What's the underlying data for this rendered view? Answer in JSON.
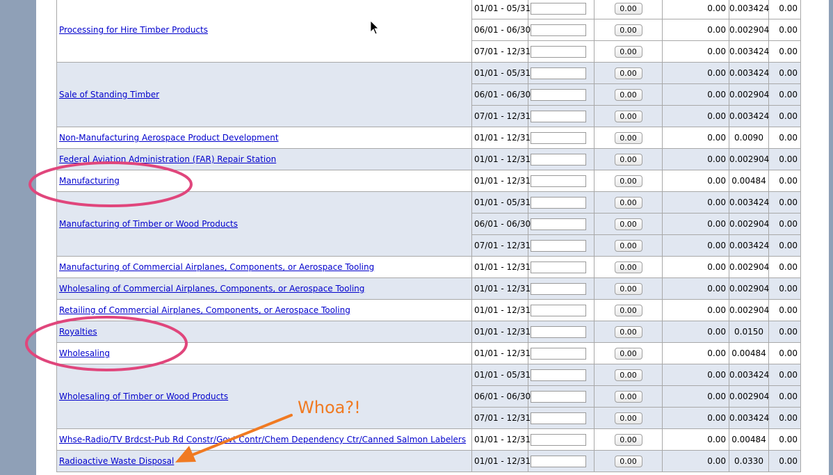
{
  "rows": [
    {
      "name": "Processing for Hire Timber Products",
      "alt": false,
      "periods": [
        {
          "dates": "01/01 - 05/31",
          "button": "0.00",
          "amount": "0.00",
          "rate": "0.003424",
          "tax": "0.00"
        },
        {
          "dates": "06/01 - 06/30",
          "button": "0.00",
          "amount": "0.00",
          "rate": "0.002904",
          "tax": "0.00"
        },
        {
          "dates": "07/01 - 12/31",
          "button": "0.00",
          "amount": "0.00",
          "rate": "0.003424",
          "tax": "0.00"
        }
      ]
    },
    {
      "name": "Sale of Standing Timber",
      "alt": true,
      "periods": [
        {
          "dates": "01/01 - 05/31",
          "button": "0.00",
          "amount": "0.00",
          "rate": "0.003424",
          "tax": "0.00"
        },
        {
          "dates": "06/01 - 06/30",
          "button": "0.00",
          "amount": "0.00",
          "rate": "0.002904",
          "tax": "0.00"
        },
        {
          "dates": "07/01 - 12/31",
          "button": "0.00",
          "amount": "0.00",
          "rate": "0.003424",
          "tax": "0.00"
        }
      ]
    },
    {
      "name": "Non-Manufacturing Aerospace Product Development",
      "alt": false,
      "periods": [
        {
          "dates": "01/01 - 12/31",
          "button": "0.00",
          "amount": "0.00",
          "rate": "0.0090",
          "tax": "0.00"
        }
      ]
    },
    {
      "name": "Federal Aviation Administration (FAR) Repair Station",
      "alt": true,
      "periods": [
        {
          "dates": "01/01 - 12/31",
          "button": "0.00",
          "amount": "0.00",
          "rate": "0.002904",
          "tax": "0.00"
        }
      ]
    },
    {
      "name": "Manufacturing",
      "alt": false,
      "periods": [
        {
          "dates": "01/01 - 12/31",
          "button": "0.00",
          "amount": "0.00",
          "rate": "0.00484",
          "tax": "0.00"
        }
      ]
    },
    {
      "name": "Manufacturing of Timber or Wood Products",
      "alt": true,
      "periods": [
        {
          "dates": "01/01 - 05/31",
          "button": "0.00",
          "amount": "0.00",
          "rate": "0.003424",
          "tax": "0.00"
        },
        {
          "dates": "06/01 - 06/30",
          "button": "0.00",
          "amount": "0.00",
          "rate": "0.002904",
          "tax": "0.00"
        },
        {
          "dates": "07/01 - 12/31",
          "button": "0.00",
          "amount": "0.00",
          "rate": "0.003424",
          "tax": "0.00"
        }
      ]
    },
    {
      "name": "Manufacturing of Commercial Airplanes, Components, or Aerospace Tooling",
      "alt": false,
      "periods": [
        {
          "dates": "01/01 - 12/31",
          "button": "0.00",
          "amount": "0.00",
          "rate": "0.002904",
          "tax": "0.00"
        }
      ]
    },
    {
      "name": "Wholesaling of Commercial Airplanes, Components, or Aerospace Tooling",
      "alt": true,
      "periods": [
        {
          "dates": "01/01 - 12/31",
          "button": "0.00",
          "amount": "0.00",
          "rate": "0.002904",
          "tax": "0.00"
        }
      ]
    },
    {
      "name": "Retailing of Commercial Airplanes, Components, or Aerospace Tooling",
      "alt": false,
      "periods": [
        {
          "dates": "01/01 - 12/31",
          "button": "0.00",
          "amount": "0.00",
          "rate": "0.002904",
          "tax": "0.00"
        }
      ]
    },
    {
      "name": "Royalties",
      "alt": true,
      "periods": [
        {
          "dates": "01/01 - 12/31",
          "button": "0.00",
          "amount": "0.00",
          "rate": "0.0150",
          "tax": "0.00"
        }
      ]
    },
    {
      "name": "Wholesaling",
      "alt": false,
      "periods": [
        {
          "dates": "01/01 - 12/31",
          "button": "0.00",
          "amount": "0.00",
          "rate": "0.00484",
          "tax": "0.00"
        }
      ]
    },
    {
      "name": "Wholesaling of Timber or Wood Products",
      "alt": true,
      "periods": [
        {
          "dates": "01/01 - 05/31",
          "button": "0.00",
          "amount": "0.00",
          "rate": "0.003424",
          "tax": "0.00"
        },
        {
          "dates": "06/01 - 06/30",
          "button": "0.00",
          "amount": "0.00",
          "rate": "0.002904",
          "tax": "0.00"
        },
        {
          "dates": "07/01 - 12/31",
          "button": "0.00",
          "amount": "0.00",
          "rate": "0.003424",
          "tax": "0.00"
        }
      ]
    },
    {
      "name": "Whse-Radio/TV Brdcst-Pub Rd Constr/Govt Contr/Chem Dependency Ctr/Canned Salmon Labelers",
      "alt": false,
      "periods": [
        {
          "dates": "01/01 - 12/31",
          "button": "0.00",
          "amount": "0.00",
          "rate": "0.00484",
          "tax": "0.00"
        }
      ]
    },
    {
      "name": "Radioactive Waste Disposal",
      "alt": true,
      "periods": [
        {
          "dates": "01/01 - 12/31",
          "button": "0.00",
          "amount": "0.00",
          "rate": "0.0330",
          "tax": "0.00"
        }
      ]
    }
  ],
  "annotation": {
    "text": "Whoa?!",
    "ellipse_color": "#e0467c",
    "arrow_color": "#f07a22"
  }
}
